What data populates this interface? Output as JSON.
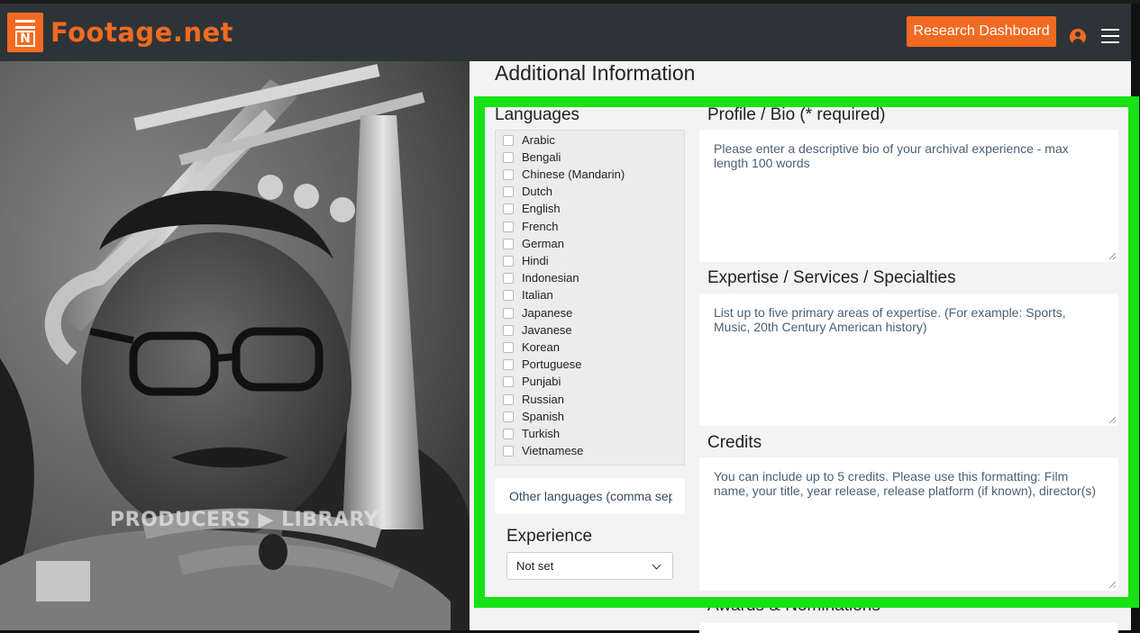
{
  "header": {
    "brand": "Footage.net",
    "logo_letter": "N",
    "research_dashboard_label": "Research Dashboard",
    "user_icon": "user-circle-icon",
    "menu_icon": "hamburger-menu-icon"
  },
  "photo": {
    "watermark": "PRODUCERS ▶ LIBRARY"
  },
  "form": {
    "title": "Additional Information",
    "languages": {
      "label": "Languages",
      "options": [
        "Arabic",
        "Bengali",
        "Chinese (Mandarin)",
        "Dutch",
        "English",
        "French",
        "German",
        "Hindi",
        "Indonesian",
        "Italian",
        "Japanese",
        "Javanese",
        "Korean",
        "Portuguese",
        "Punjabi",
        "Russian",
        "Spanish",
        "Turkish",
        "Vietnamese"
      ],
      "other_placeholder": "Other languages (comma separated)"
    },
    "experience": {
      "label": "Experience",
      "selected": "Not set"
    },
    "bio": {
      "label": "Profile / Bio (* required)",
      "placeholder": "Please enter a descriptive bio of your archival experience - max length 100 words"
    },
    "expertise": {
      "label": "Expertise / Services / Specialties",
      "placeholder": "List up to five primary areas of expertise. (For example: Sports, Music, 20th Century American history)"
    },
    "credits": {
      "label": "Credits",
      "placeholder": "You can include up to 5 credits. Please use this formatting: Film name, your title, year release, release platform (if known), director(s)"
    },
    "awards": {
      "label": "Awards & Nominations"
    }
  },
  "colors": {
    "brand_orange": "#f26a21",
    "navbar": "#2d3437",
    "highlight": "#16e216"
  }
}
